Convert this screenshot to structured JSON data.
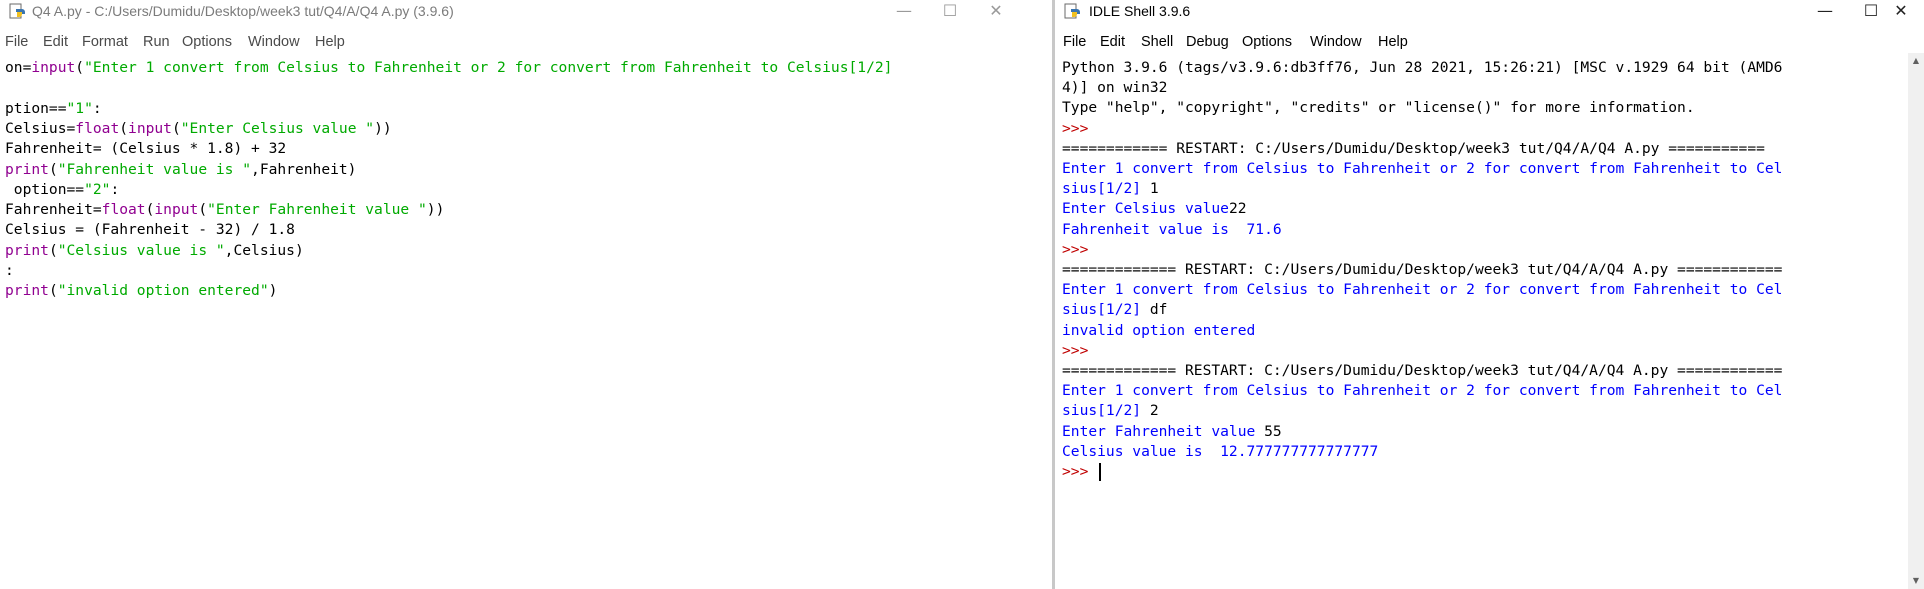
{
  "editor": {
    "title": "Q4 A.py - C:/Users/Dumidu/Desktop/week3 tut/Q4/A/Q4 A.py (3.9.6)",
    "controls": {
      "minimize": "—",
      "maximize": "☐",
      "close": "✕"
    },
    "menu": [
      "File",
      "Edit",
      "Format",
      "Run",
      "Options",
      "Window",
      "Help"
    ],
    "code_lines": [
      [
        {
          "t": "on=",
          "c": ""
        },
        {
          "t": "input",
          "c": "bi"
        },
        {
          "t": "(",
          "c": ""
        },
        {
          "t": "\"Enter 1 convert from Celsius to Fahrenheit or 2 for convert from Fahrenheit to Celsius[1/2]",
          "c": "str"
        }
      ],
      [],
      [
        {
          "t": "ption==",
          "c": ""
        },
        {
          "t": "\"1\"",
          "c": "str"
        },
        {
          "t": ":",
          "c": ""
        }
      ],
      [
        {
          "t": "Celsius=",
          "c": ""
        },
        {
          "t": "float",
          "c": "bi"
        },
        {
          "t": "(",
          "c": ""
        },
        {
          "t": "input",
          "c": "bi"
        },
        {
          "t": "(",
          "c": ""
        },
        {
          "t": "\"Enter Celsius value \"",
          "c": "str"
        },
        {
          "t": "))",
          "c": ""
        }
      ],
      [
        {
          "t": "Fahrenheit= (Celsius * 1.8) + 32",
          "c": ""
        }
      ],
      [
        {
          "t": "print",
          "c": "bi"
        },
        {
          "t": "(",
          "c": ""
        },
        {
          "t": "\"Fahrenheit value is \"",
          "c": "str"
        },
        {
          "t": ",Fahrenheit)",
          "c": ""
        }
      ],
      [
        {
          "t": " option==",
          "c": ""
        },
        {
          "t": "\"2\"",
          "c": "str"
        },
        {
          "t": ":",
          "c": ""
        }
      ],
      [
        {
          "t": "Fahrenheit=",
          "c": ""
        },
        {
          "t": "float",
          "c": "bi"
        },
        {
          "t": "(",
          "c": ""
        },
        {
          "t": "input",
          "c": "bi"
        },
        {
          "t": "(",
          "c": ""
        },
        {
          "t": "\"Enter Fahrenheit value \"",
          "c": "str"
        },
        {
          "t": "))",
          "c": ""
        }
      ],
      [
        {
          "t": "Celsius = (Fahrenheit - 32) / 1.8",
          "c": ""
        }
      ],
      [
        {
          "t": "print",
          "c": "bi"
        },
        {
          "t": "(",
          "c": ""
        },
        {
          "t": "\"Celsius value is \"",
          "c": "str"
        },
        {
          "t": ",Celsius)",
          "c": ""
        }
      ],
      [
        {
          "t": ":",
          "c": ""
        }
      ],
      [
        {
          "t": "print",
          "c": "bi"
        },
        {
          "t": "(",
          "c": ""
        },
        {
          "t": "\"invalid option entered\"",
          "c": "str"
        },
        {
          "t": ")",
          "c": ""
        }
      ]
    ]
  },
  "shell": {
    "title": "IDLE Shell 3.9.6",
    "controls": {
      "minimize": "—",
      "maximize": "☐",
      "close": "✕"
    },
    "menu": [
      "File",
      "Edit",
      "Shell",
      "Debug",
      "Options",
      "Window",
      "Help"
    ],
    "lines": [
      [
        {
          "t": "Python 3.9.6 (tags/v3.9.6:db3ff76, Jun 28 2021, 15:26:21) [MSC v.1929 64 bit (AMD6",
          "c": ""
        }
      ],
      [
        {
          "t": "4)] on win32",
          "c": ""
        }
      ],
      [
        {
          "t": "Type \"help\", \"copyright\", \"credits\" or \"license()\" for more information.",
          "c": ""
        }
      ],
      [
        {
          "t": ">>>",
          "c": "prompt"
        }
      ],
      [
        {
          "t": "============ RESTART: C:/Users/Dumidu/Desktop/week3 tut/Q4/A/Q4 A.py ===========",
          "c": ""
        }
      ],
      [
        {
          "t": "Enter 1 convert from Celsius to Fahrenheit or 2 for convert from Fahrenheit to Cel",
          "c": "out"
        }
      ],
      [
        {
          "t": "sius[1/2] ",
          "c": "out"
        },
        {
          "t": "1",
          "c": ""
        }
      ],
      [
        {
          "t": "Enter Celsius value",
          "c": "out"
        },
        {
          "t": "22",
          "c": ""
        }
      ],
      [
        {
          "t": "Fahrenheit value is  71.6",
          "c": "out"
        }
      ],
      [
        {
          "t": ">>>",
          "c": "prompt"
        }
      ],
      [
        {
          "t": "============= RESTART: C:/Users/Dumidu/Desktop/week3 tut/Q4/A/Q4 A.py ============",
          "c": ""
        }
      ],
      [
        {
          "t": "Enter 1 convert from Celsius to Fahrenheit or 2 for convert from Fahrenheit to Cel",
          "c": "out"
        }
      ],
      [
        {
          "t": "sius[1/2] ",
          "c": "out"
        },
        {
          "t": "df",
          "c": ""
        }
      ],
      [
        {
          "t": "invalid option entered",
          "c": "out"
        }
      ],
      [
        {
          "t": ">>>",
          "c": "prompt"
        }
      ],
      [
        {
          "t": "============= RESTART: C:/Users/Dumidu/Desktop/week3 tut/Q4/A/Q4 A.py ============",
          "c": ""
        }
      ],
      [
        {
          "t": "Enter 1 convert from Celsius to Fahrenheit or 2 for convert from Fahrenheit to Cel",
          "c": "out"
        }
      ],
      [
        {
          "t": "sius[1/2] ",
          "c": "out"
        },
        {
          "t": "2",
          "c": ""
        }
      ],
      [
        {
          "t": "Enter Fahrenheit value ",
          "c": "out"
        },
        {
          "t": "55",
          "c": ""
        }
      ],
      [
        {
          "t": "Celsius value is  12.777777777777777",
          "c": "out"
        }
      ],
      [
        {
          "t": ">>> ",
          "c": "prompt"
        }
      ]
    ]
  },
  "colors": {
    "builtin": "#900090",
    "string": "#00aa00",
    "stdout": "#0000ff",
    "prompt": "#c00000"
  },
  "icons": {
    "python_file": "python-idle-icon",
    "scroll_up": "up-arrow",
    "scroll_down": "down-arrow"
  }
}
